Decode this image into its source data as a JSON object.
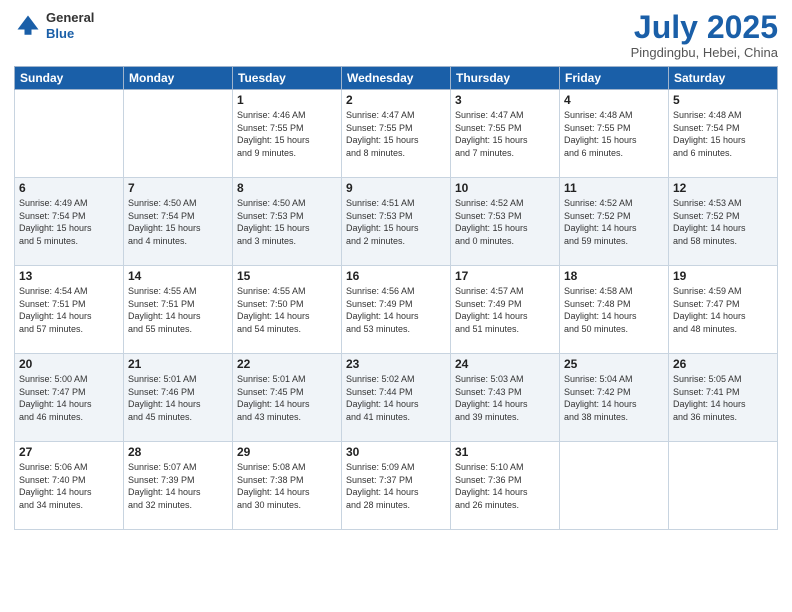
{
  "header": {
    "logo_general": "General",
    "logo_blue": "Blue",
    "month_title": "July 2025",
    "subtitle": "Pingdingbu, Hebei, China"
  },
  "days_of_week": [
    "Sunday",
    "Monday",
    "Tuesday",
    "Wednesday",
    "Thursday",
    "Friday",
    "Saturday"
  ],
  "weeks": [
    [
      {
        "day": "",
        "detail": ""
      },
      {
        "day": "",
        "detail": ""
      },
      {
        "day": "1",
        "detail": "Sunrise: 4:46 AM\nSunset: 7:55 PM\nDaylight: 15 hours\nand 9 minutes."
      },
      {
        "day": "2",
        "detail": "Sunrise: 4:47 AM\nSunset: 7:55 PM\nDaylight: 15 hours\nand 8 minutes."
      },
      {
        "day": "3",
        "detail": "Sunrise: 4:47 AM\nSunset: 7:55 PM\nDaylight: 15 hours\nand 7 minutes."
      },
      {
        "day": "4",
        "detail": "Sunrise: 4:48 AM\nSunset: 7:55 PM\nDaylight: 15 hours\nand 6 minutes."
      },
      {
        "day": "5",
        "detail": "Sunrise: 4:48 AM\nSunset: 7:54 PM\nDaylight: 15 hours\nand 6 minutes."
      }
    ],
    [
      {
        "day": "6",
        "detail": "Sunrise: 4:49 AM\nSunset: 7:54 PM\nDaylight: 15 hours\nand 5 minutes."
      },
      {
        "day": "7",
        "detail": "Sunrise: 4:50 AM\nSunset: 7:54 PM\nDaylight: 15 hours\nand 4 minutes."
      },
      {
        "day": "8",
        "detail": "Sunrise: 4:50 AM\nSunset: 7:53 PM\nDaylight: 15 hours\nand 3 minutes."
      },
      {
        "day": "9",
        "detail": "Sunrise: 4:51 AM\nSunset: 7:53 PM\nDaylight: 15 hours\nand 2 minutes."
      },
      {
        "day": "10",
        "detail": "Sunrise: 4:52 AM\nSunset: 7:53 PM\nDaylight: 15 hours\nand 0 minutes."
      },
      {
        "day": "11",
        "detail": "Sunrise: 4:52 AM\nSunset: 7:52 PM\nDaylight: 14 hours\nand 59 minutes."
      },
      {
        "day": "12",
        "detail": "Sunrise: 4:53 AM\nSunset: 7:52 PM\nDaylight: 14 hours\nand 58 minutes."
      }
    ],
    [
      {
        "day": "13",
        "detail": "Sunrise: 4:54 AM\nSunset: 7:51 PM\nDaylight: 14 hours\nand 57 minutes."
      },
      {
        "day": "14",
        "detail": "Sunrise: 4:55 AM\nSunset: 7:51 PM\nDaylight: 14 hours\nand 55 minutes."
      },
      {
        "day": "15",
        "detail": "Sunrise: 4:55 AM\nSunset: 7:50 PM\nDaylight: 14 hours\nand 54 minutes."
      },
      {
        "day": "16",
        "detail": "Sunrise: 4:56 AM\nSunset: 7:49 PM\nDaylight: 14 hours\nand 53 minutes."
      },
      {
        "day": "17",
        "detail": "Sunrise: 4:57 AM\nSunset: 7:49 PM\nDaylight: 14 hours\nand 51 minutes."
      },
      {
        "day": "18",
        "detail": "Sunrise: 4:58 AM\nSunset: 7:48 PM\nDaylight: 14 hours\nand 50 minutes."
      },
      {
        "day": "19",
        "detail": "Sunrise: 4:59 AM\nSunset: 7:47 PM\nDaylight: 14 hours\nand 48 minutes."
      }
    ],
    [
      {
        "day": "20",
        "detail": "Sunrise: 5:00 AM\nSunset: 7:47 PM\nDaylight: 14 hours\nand 46 minutes."
      },
      {
        "day": "21",
        "detail": "Sunrise: 5:01 AM\nSunset: 7:46 PM\nDaylight: 14 hours\nand 45 minutes."
      },
      {
        "day": "22",
        "detail": "Sunrise: 5:01 AM\nSunset: 7:45 PM\nDaylight: 14 hours\nand 43 minutes."
      },
      {
        "day": "23",
        "detail": "Sunrise: 5:02 AM\nSunset: 7:44 PM\nDaylight: 14 hours\nand 41 minutes."
      },
      {
        "day": "24",
        "detail": "Sunrise: 5:03 AM\nSunset: 7:43 PM\nDaylight: 14 hours\nand 39 minutes."
      },
      {
        "day": "25",
        "detail": "Sunrise: 5:04 AM\nSunset: 7:42 PM\nDaylight: 14 hours\nand 38 minutes."
      },
      {
        "day": "26",
        "detail": "Sunrise: 5:05 AM\nSunset: 7:41 PM\nDaylight: 14 hours\nand 36 minutes."
      }
    ],
    [
      {
        "day": "27",
        "detail": "Sunrise: 5:06 AM\nSunset: 7:40 PM\nDaylight: 14 hours\nand 34 minutes."
      },
      {
        "day": "28",
        "detail": "Sunrise: 5:07 AM\nSunset: 7:39 PM\nDaylight: 14 hours\nand 32 minutes."
      },
      {
        "day": "29",
        "detail": "Sunrise: 5:08 AM\nSunset: 7:38 PM\nDaylight: 14 hours\nand 30 minutes."
      },
      {
        "day": "30",
        "detail": "Sunrise: 5:09 AM\nSunset: 7:37 PM\nDaylight: 14 hours\nand 28 minutes."
      },
      {
        "day": "31",
        "detail": "Sunrise: 5:10 AM\nSunset: 7:36 PM\nDaylight: 14 hours\nand 26 minutes."
      },
      {
        "day": "",
        "detail": ""
      },
      {
        "day": "",
        "detail": ""
      }
    ]
  ]
}
